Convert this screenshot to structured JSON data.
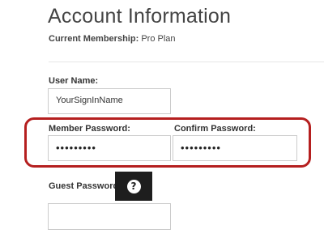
{
  "header": {
    "title": "Account Information",
    "membership_label": "Current Membership:",
    "membership_value": "Pro Plan"
  },
  "form": {
    "username": {
      "label": "User Name:",
      "value": "YourSignInName"
    },
    "member_password": {
      "label": "Member Password:",
      "value": "•••••••••"
    },
    "confirm_password": {
      "label": "Confirm Password:",
      "value": "•••••••••"
    },
    "guest_password": {
      "label": "Guest Password:",
      "value": "",
      "help_glyph": "?"
    }
  },
  "colors": {
    "highlight": "#b51f1f",
    "help_badge": "#1e1e1e"
  },
  "icons": {
    "help": "question-circle-icon"
  }
}
